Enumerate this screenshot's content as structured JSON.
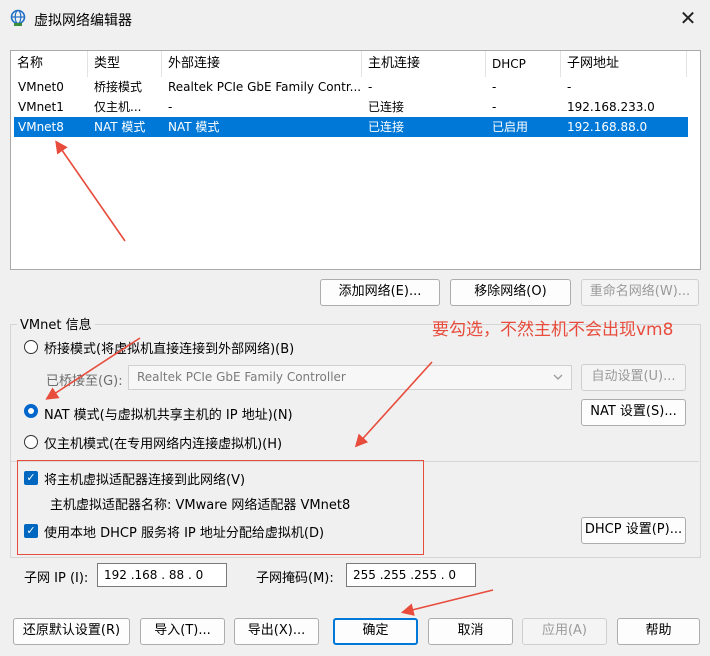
{
  "window": {
    "title": "虚拟网络编辑器",
    "close_glyph": "✕"
  },
  "table": {
    "columns": [
      "名称",
      "类型",
      "外部连接",
      "主机连接",
      "DHCP",
      "子网地址"
    ],
    "rows": [
      [
        "VMnet0",
        "桥接模式",
        "Realtek PCIe GbE Family Contr...",
        "-",
        "-",
        "-"
      ],
      [
        "VMnet1",
        "仅主机...",
        "-",
        "已连接",
        "-",
        "192.168.233.0"
      ],
      [
        "VMnet8",
        "NAT 模式",
        "NAT 模式",
        "已连接",
        "已启用",
        "192.168.88.0"
      ]
    ],
    "selected_index": 2
  },
  "network_buttons": {
    "add": "添加网络(E)...",
    "remove": "移除网络(O)",
    "rename": "重命名网络(W)..."
  },
  "vmnet_info": {
    "group_title": "VMnet 信息",
    "bridge_mode": "桥接模式(将虚拟机直接连接到外部网络)(B)",
    "bridged_to_label": "已桥接至(G):",
    "bridged_to_value": "Realtek PCIe GbE Family Controller",
    "auto_settings": "自动设置(U)...",
    "nat_mode": "NAT 模式(与虚拟机共享主机的 IP 地址)(N)",
    "nat_settings": "NAT 设置(S)...",
    "host_only": "仅主机模式(在专用网络内连接虚拟机)(H)",
    "connect_adapter": "将主机虚拟适配器连接到此网络(V)",
    "adapter_name": "主机虚拟适配器名称: VMware 网络适配器 VMnet8",
    "use_dhcp": "使用本地 DHCP 服务将 IP 地址分配给虚拟机(D)",
    "dhcp_settings": "DHCP 设置(P)...",
    "subnet_ip_label": "子网 IP (I):",
    "subnet_ip_value": "192 .168 . 88 . 0",
    "subnet_mask_label": "子网掩码(M):",
    "subnet_mask_value": "255 .255 .255 . 0"
  },
  "annotation": {
    "text": "要勾选，不然主机不会出现vm8",
    "color": "#e74c3c"
  },
  "footer": {
    "restore": "还原默认设置(R)",
    "import": "导入(T)...",
    "export": "导出(X)...",
    "ok": "确定",
    "cancel": "取消",
    "apply": "应用(A)",
    "help": "帮助"
  },
  "colors": {
    "selection": "#0078d7",
    "accent": "#0067c0",
    "annotation": "#e74c3c"
  }
}
